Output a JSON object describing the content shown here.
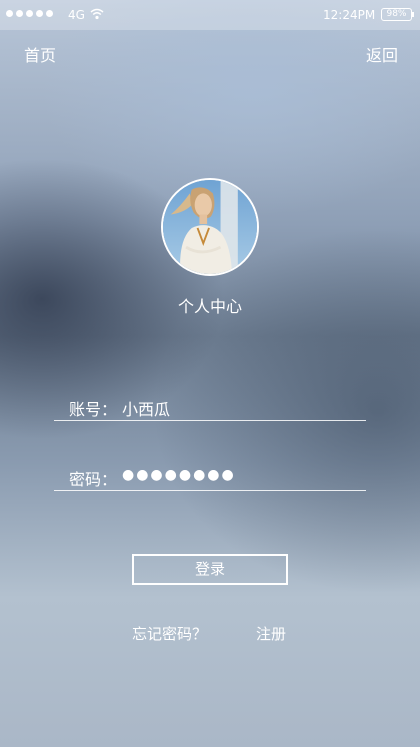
{
  "status_bar": {
    "network": "4G",
    "time": "12:24PM",
    "battery": "98%"
  },
  "nav": {
    "home_label": "首页",
    "back_label": "返回"
  },
  "profile": {
    "title": "个人中心"
  },
  "form": {
    "account_label": "账号：",
    "account_value": "小西瓜",
    "password_label": "密码：",
    "password_value": "●●●●●●●●"
  },
  "actions": {
    "login_label": "登录",
    "forgot_label": "忘记密码？",
    "register_label": "注册"
  }
}
